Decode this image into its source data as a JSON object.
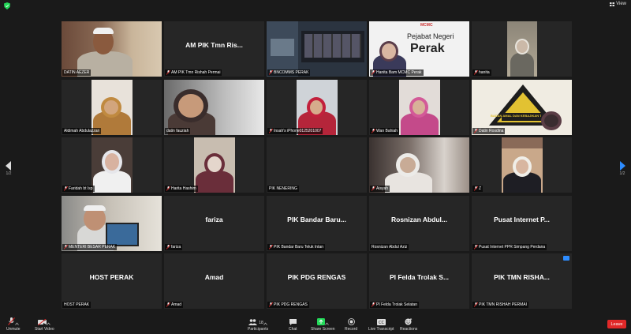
{
  "top": {
    "view_label": "View"
  },
  "nav": {
    "left_page": "1/2",
    "right_page": "1/2"
  },
  "tiles": [
    {
      "label": "DATIN AEZER",
      "name_text": ""
    },
    {
      "label": "AM PIK Tmn Rishah Permai",
      "name_text": "AM PIK Tmn Ris..."
    },
    {
      "label": "BNCOMMS PERAK",
      "name_text": ""
    },
    {
      "label": "Hanita Bam MCMC Perak",
      "name_text": ""
    },
    {
      "label": "hanita",
      "name_text": ""
    },
    {
      "label": "Aldimah Abdulazzan",
      "name_text": ""
    },
    {
      "label": "datin fauziah",
      "name_text": ""
    },
    {
      "label": "Insah's iPhone0125201007",
      "name_text": ""
    },
    {
      "label": "Wan Bahiah",
      "name_text": ""
    },
    {
      "label": "Datin Rosdina",
      "name_text": ""
    },
    {
      "label": "Faridah bt Isp",
      "name_text": ""
    },
    {
      "label": "Harita Hashim",
      "name_text": ""
    },
    {
      "label": "PIK NENERING",
      "name_text": ""
    },
    {
      "label": "Aisyah",
      "name_text": ""
    },
    {
      "label": "Z",
      "name_text": ""
    },
    {
      "label": "MENTERI BESAR PERAK",
      "name_text": ""
    },
    {
      "label": "fariza",
      "name_text": "fariza"
    },
    {
      "label": "PIK Bandar Baru Teluk Intan",
      "name_text": "PIK Bandar Baru..."
    },
    {
      "label": "Rosnizan Abdul Aziz",
      "name_text": "Rosnizan  Abdul..."
    },
    {
      "label": "Pusat Internet PPR Simpang Perdana",
      "name_text": "Pusat Internet P..."
    },
    {
      "label": "HOST PERAK",
      "name_text": "HOST PERAK"
    },
    {
      "label": "Amad",
      "name_text": "Amad"
    },
    {
      "label": "PIK PDG RENGAS",
      "name_text": "PIK PDG RENGAS"
    },
    {
      "label": "PI Felda Trolak Selatan",
      "name_text": "PI Felda Trolak S..."
    },
    {
      "label": "PIK TMN RISHAH PERMAI",
      "name_text": "PIK TMN RISHA..."
    }
  ],
  "slide": {
    "title_line1": "Pejabat Negeri",
    "title_line2": "Perak",
    "logo_text": "MCMC"
  },
  "banner": {
    "text": "BADAN AMAL DAN KEBAJIKAN TERI NEGERI"
  },
  "toolbar": {
    "unmute": "Unmute",
    "start_video": "Start Video",
    "participants": "Participants",
    "participants_count": "18",
    "chat": "Chat",
    "share_screen": "Share Screen",
    "record": "Record",
    "live_transcript": "Live Transcript",
    "reactions": "Reactions",
    "leave": "Leave"
  },
  "colors": {
    "active_border": "#c6d84a",
    "share_green": "#23d959",
    "leave_red": "#e02828",
    "accent_blue": "#2d8cff"
  }
}
